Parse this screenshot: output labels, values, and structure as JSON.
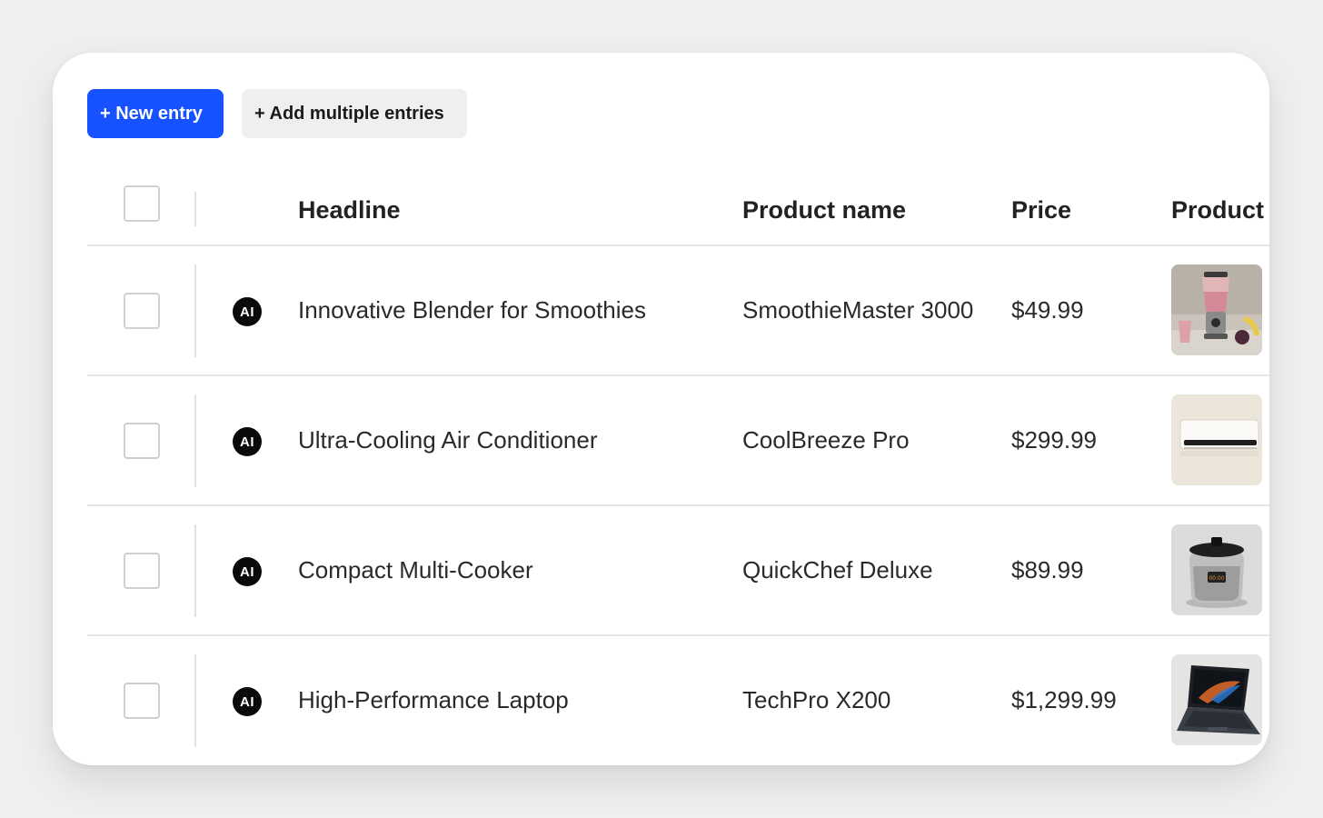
{
  "toolbar": {
    "new_entry_label": "+ New entry",
    "add_multiple_label": "+ Add multiple entries"
  },
  "table": {
    "columns": [
      "Headline",
      "Product name",
      "Price",
      "Product"
    ],
    "rows": [
      {
        "badge": "AI",
        "headline": "Innovative Blender for Smoothies",
        "product_name": "SmoothieMaster 3000",
        "price": "$49.99",
        "image": "blender-image"
      },
      {
        "badge": "AI",
        "headline": "Ultra-Cooling Air Conditioner",
        "product_name": "CoolBreeze Pro",
        "price": "$299.99",
        "image": "air-conditioner-image"
      },
      {
        "badge": "AI",
        "headline": "Compact Multi-Cooker",
        "product_name": "QuickChef Deluxe",
        "price": "$89.99",
        "image": "multi-cooker-image"
      },
      {
        "badge": "AI",
        "headline": "High-Performance Laptop",
        "product_name": "TechPro X200",
        "price": "$1,299.99",
        "image": "laptop-image"
      }
    ]
  },
  "colors": {
    "primary": "#1652ff",
    "secondary_bg": "#efefef",
    "badge_bg": "#0a0a0a"
  }
}
